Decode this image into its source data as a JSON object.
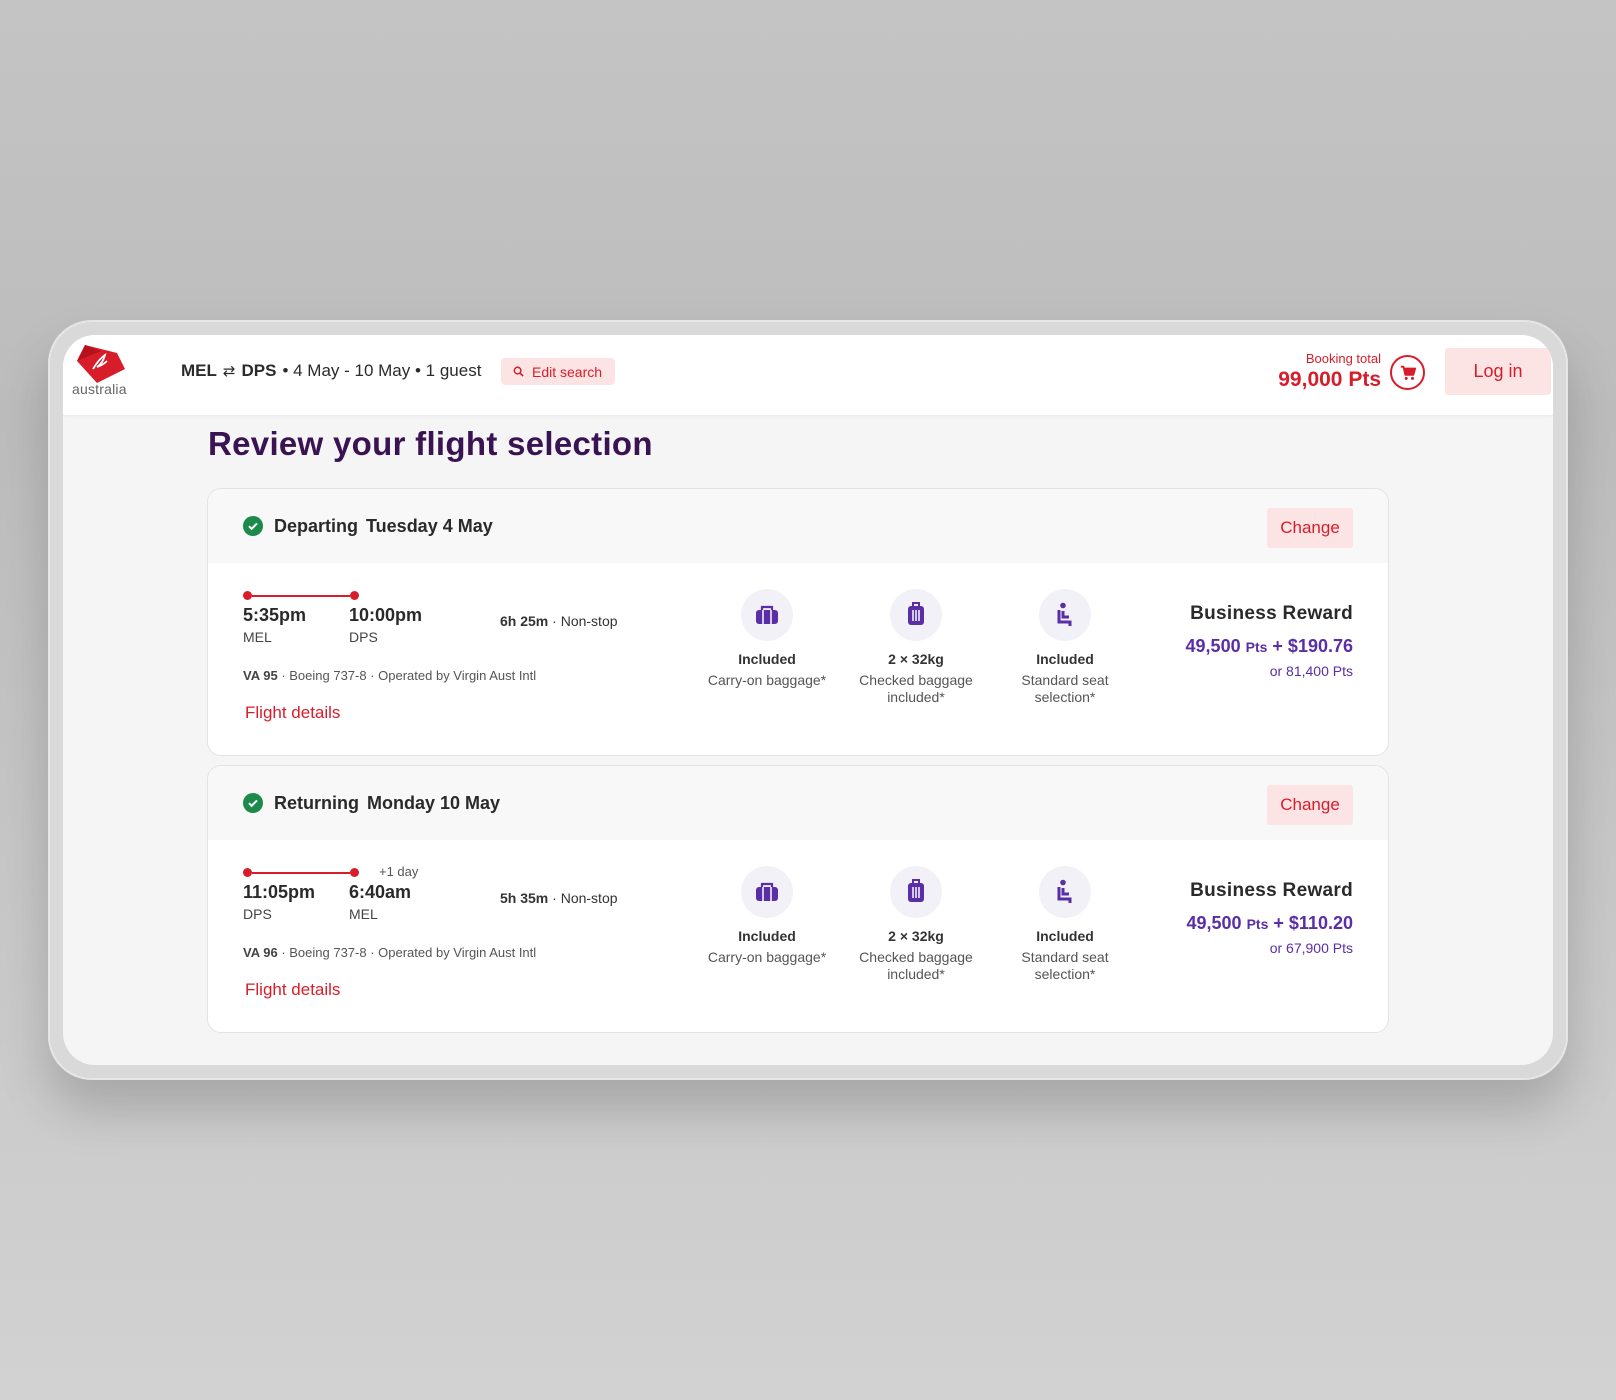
{
  "brand": {
    "word": "australia",
    "accent": "#d81d2a",
    "purple": "#5a2ea6",
    "title_color": "#3a1352"
  },
  "header": {
    "origin": "MEL",
    "destination": "DPS",
    "details": "• 4 May - 10 May • 1 guest",
    "edit_search_label": "Edit search",
    "booking_total_label": "Booking total",
    "booking_total_value": "99,000 Pts",
    "login_label": "Log in"
  },
  "page_title": "Review your flight selection",
  "flights": [
    {
      "direction": "Departing",
      "date": "Tuesday 4 May",
      "change_label": "Change",
      "depart_time": "5:35pm",
      "depart_port": "MEL",
      "arrive_time": "10:00pm",
      "arrive_port": "DPS",
      "plus_day": "",
      "duration": "6h 25m",
      "stops": "Non-stop",
      "flight_no": "VA 95",
      "meta": "· Boeing 737-8 · Operated by Virgin Aust Intl",
      "details_link": "Flight details",
      "amenities": [
        {
          "icon": "carry-on-bag-icon",
          "title": "Included",
          "desc": "Carry-on baggage*"
        },
        {
          "icon": "checked-bag-icon",
          "title": "2 × 32kg",
          "desc": "Checked baggage included*"
        },
        {
          "icon": "seat-icon",
          "title": "Included",
          "desc": "Standard seat selection*"
        }
      ],
      "fare_name": "Business Reward",
      "fare_pts": "49,500",
      "fare_pts_unit": "Pts",
      "fare_cash": "+ $190.76",
      "fare_alt": "or 81,400 Pts"
    },
    {
      "direction": "Returning",
      "date": "Monday 10 May",
      "change_label": "Change",
      "depart_time": "11:05pm",
      "depart_port": "DPS",
      "arrive_time": "6:40am",
      "arrive_port": "MEL",
      "plus_day": "+1 day",
      "duration": "5h 35m",
      "stops": "Non-stop",
      "flight_no": "VA 96",
      "meta": "· Boeing 737-8 · Operated by Virgin Aust Intl",
      "details_link": "Flight details",
      "amenities": [
        {
          "icon": "carry-on-bag-icon",
          "title": "Included",
          "desc": "Carry-on baggage*"
        },
        {
          "icon": "checked-bag-icon",
          "title": "2 × 32kg",
          "desc": "Checked baggage included*"
        },
        {
          "icon": "seat-icon",
          "title": "Included",
          "desc": "Standard seat selection*"
        }
      ],
      "fare_name": "Business Reward",
      "fare_pts": "49,500",
      "fare_pts_unit": "Pts",
      "fare_cash": "+ $110.20",
      "fare_alt": "or 67,900 Pts"
    }
  ]
}
